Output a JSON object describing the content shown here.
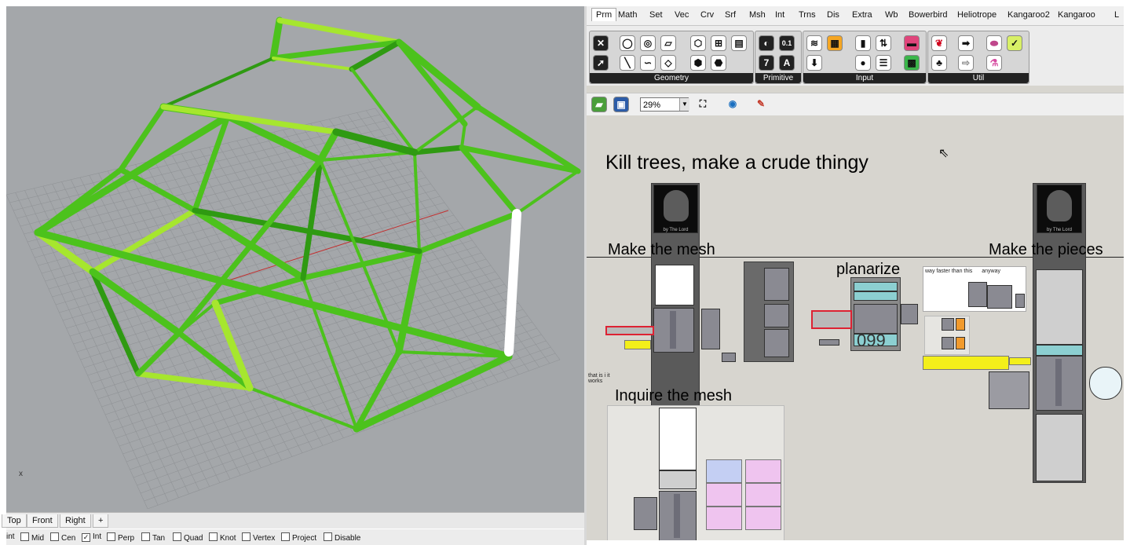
{
  "rhino": {
    "axis_label": "x",
    "view_tabs": [
      "Top",
      "Front",
      "Right",
      "+"
    ],
    "snaps": [
      {
        "label": "int",
        "checked": false
      },
      {
        "label": "Mid",
        "checked": false
      },
      {
        "label": "Cen",
        "checked": false
      },
      {
        "label": "Int",
        "checked": true
      },
      {
        "label": "Perp",
        "checked": false
      },
      {
        "label": "Tan",
        "checked": false
      },
      {
        "label": "Quad",
        "checked": false
      },
      {
        "label": "Knot",
        "checked": false
      },
      {
        "label": "Vertex",
        "checked": false
      },
      {
        "label": "Project",
        "checked": false
      },
      {
        "label": "Disable",
        "checked": false
      }
    ]
  },
  "grasshopper": {
    "tabs": [
      "Prm",
      "Math",
      "Set",
      "Vec",
      "Crv",
      "Srf",
      "Msh",
      "Int",
      "Trns",
      "Dis",
      "Extra",
      "Wb",
      "Bowerbird",
      "Heliotrope",
      "Kangaroo2",
      "Kangaroo",
      "L"
    ],
    "active_tab": "Prm",
    "groups": [
      {
        "label": "Geometry"
      },
      {
        "label": "Primitive"
      },
      {
        "label": "Input"
      },
      {
        "label": "Util"
      }
    ],
    "primitive_icons": [
      "0.1",
      "7",
      "A"
    ],
    "zoom": "29%",
    "canvas": {
      "title": "Kill trees, make a crude thingy",
      "groups": [
        "Make the mesh",
        "planarize",
        "Make the pieces",
        "Inquire the mesh"
      ],
      "counter": "099",
      "note_text": "way faster than this",
      "note_text2": "anyway",
      "small_note": "that is i it works",
      "skull_caption": "by The Lord"
    }
  },
  "colors": {
    "strut_dark": "#2f9a12",
    "strut_mid": "#4cc21c",
    "strut_light": "#a6e62e",
    "viewport_bg": "#a4a7aa"
  }
}
